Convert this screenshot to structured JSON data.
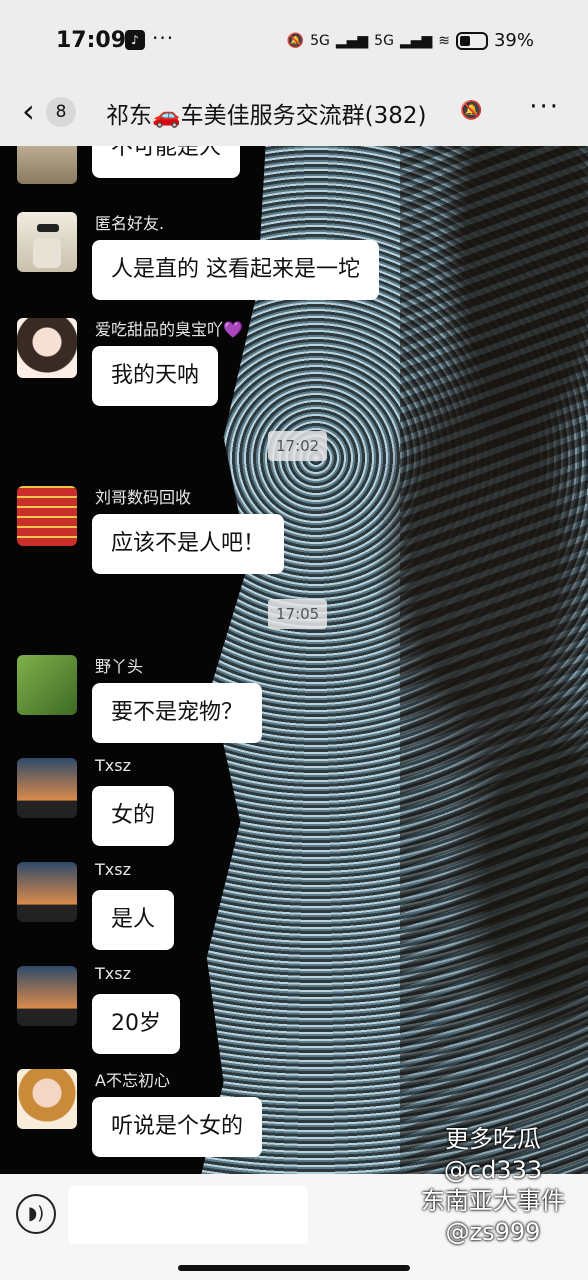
{
  "status_bar": {
    "time": "17:09",
    "app_icon": "tiktok-icon",
    "more": "···",
    "signal_1": "5G",
    "signal_2": "5G",
    "battery": "39%"
  },
  "nav": {
    "unread_count": "8",
    "title": "祁东🚗车美佳服务交流群(382)"
  },
  "messages": [
    {
      "sender": "",
      "text": "不可能是人"
    },
    {
      "sender": "匿名好友.",
      "text": "人是直的 这看起来是一坨"
    },
    {
      "sender": "爱吃甜品的臭宝吖💜",
      "text": "我的天呐"
    },
    {
      "sender": "刘哥数码回收",
      "text": "应该不是人吧！"
    },
    {
      "sender": "野丫头",
      "text": "要不是宠物？"
    },
    {
      "sender": "Txsz",
      "text": "女的"
    },
    {
      "sender": "Txsz",
      "text": "是人"
    },
    {
      "sender": "Txsz",
      "text": "20岁"
    },
    {
      "sender": "A不忘初心",
      "text": "听说是个女的"
    }
  ],
  "timestamps": [
    "17:02",
    "17:05"
  ],
  "watermark": {
    "line1": "更多吃瓜",
    "line2": "@cd333",
    "line3": "东南亚大事件",
    "line4": "@zs999"
  },
  "colors": {
    "background": "#0a0a0a",
    "bubble": "#ffffff",
    "header": "#ededed",
    "ocean_foam": "#b9d2de"
  }
}
